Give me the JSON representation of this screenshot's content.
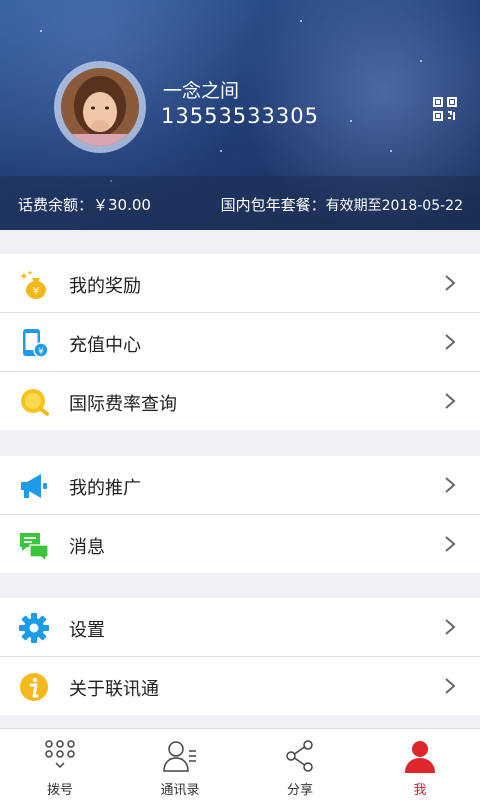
{
  "profile": {
    "username": "一念之间",
    "phone": "13553533305"
  },
  "balance": {
    "left_text": "话费余额：￥30.00",
    "package_label": "国内包年套餐：",
    "package_expiry": "有效期至2018-05-22"
  },
  "menu_groups": [
    {
      "items": [
        {
          "label": "我的奖励",
          "icon": "reward-bag-icon"
        },
        {
          "label": "充值中心",
          "icon": "recharge-phone-icon"
        },
        {
          "label": "国际费率查询",
          "icon": "rate-search-icon"
        }
      ]
    },
    {
      "items": [
        {
          "label": "我的推广",
          "icon": "megaphone-icon"
        },
        {
          "label": "消息",
          "icon": "message-chat-icon"
        }
      ]
    },
    {
      "items": [
        {
          "label": "设置",
          "icon": "gear-icon"
        },
        {
          "label": "关于联讯通",
          "icon": "info-icon"
        }
      ]
    }
  ],
  "tabbar": {
    "tabs": [
      {
        "label": "拨号",
        "icon": "dialpad-icon"
      },
      {
        "label": "通讯录",
        "icon": "contacts-icon"
      },
      {
        "label": "分享",
        "icon": "share-icon"
      },
      {
        "label": "我",
        "icon": "user-icon"
      }
    ],
    "active_index": 3
  },
  "colors": {
    "accent_red": "#e0262a",
    "icon_blue": "#1d9be8",
    "icon_yellow": "#f6b91b",
    "icon_green": "#3cc53c"
  }
}
